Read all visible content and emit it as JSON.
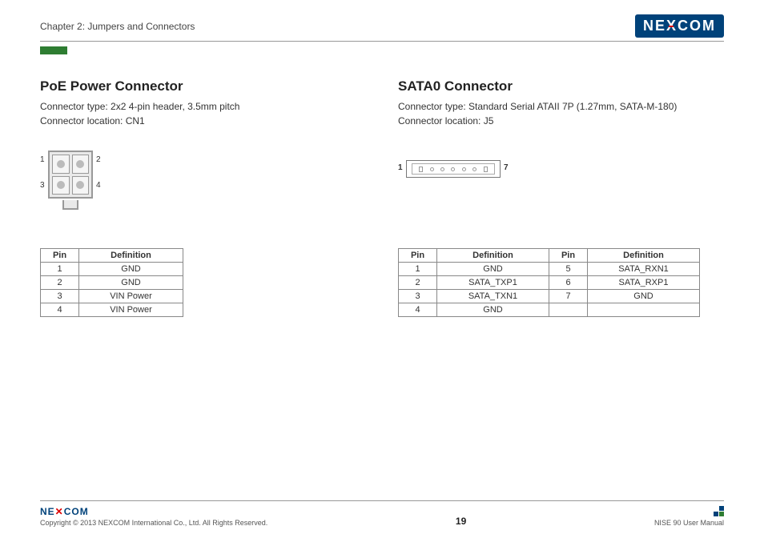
{
  "header": {
    "chapter": "Chapter 2: Jumpers and Connectors",
    "logo_text": "NE COM"
  },
  "left": {
    "title": "PoE Power Connector",
    "type_line": "Connector type: 2x2 4-pin header, 3.5mm pitch",
    "loc_line": "Connector location: CN1",
    "pin_labels": {
      "p1": "1",
      "p2": "2",
      "p3": "3",
      "p4": "4"
    },
    "table": {
      "headers": {
        "pin": "Pin",
        "def": "Definition"
      },
      "rows": [
        {
          "pin": "1",
          "def": "GND"
        },
        {
          "pin": "2",
          "def": "GND"
        },
        {
          "pin": "3",
          "def": "VIN Power"
        },
        {
          "pin": "4",
          "def": "VIN Power"
        }
      ]
    }
  },
  "right": {
    "title": "SATA0 Connector",
    "type_line": "Connector type: Standard Serial ATAII 7P (1.27mm, SATA-M-180)",
    "loc_line": "Connector location: J5",
    "pin_labels": {
      "p1": "1",
      "p7": "7"
    },
    "table": {
      "headers": {
        "pin": "Pin",
        "def": "Definition"
      },
      "rows_left": [
        {
          "pin": "1",
          "def": "GND"
        },
        {
          "pin": "2",
          "def": "SATA_TXP1"
        },
        {
          "pin": "3",
          "def": "SATA_TXN1"
        },
        {
          "pin": "4",
          "def": "GND"
        }
      ],
      "rows_right": [
        {
          "pin": "5",
          "def": "SATA_RXN1"
        },
        {
          "pin": "6",
          "def": "SATA_RXP1"
        },
        {
          "pin": "7",
          "def": "GND"
        },
        {
          "pin": "",
          "def": ""
        }
      ]
    }
  },
  "footer": {
    "logo_text": "NE COM",
    "copyright": "Copyright © 2013 NEXCOM International Co., Ltd. All Rights Reserved.",
    "page": "19",
    "manual": "NISE 90 User Manual"
  }
}
